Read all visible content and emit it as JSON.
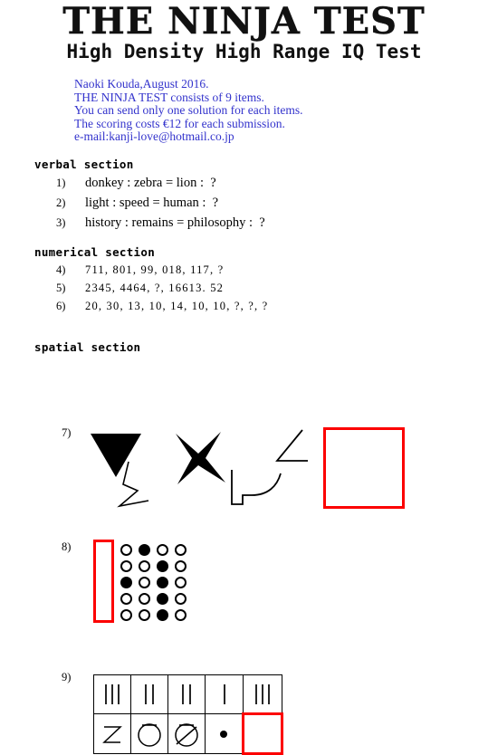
{
  "header": {
    "main_title": "THE NINJA TEST",
    "sub_title": "High Density  High Range IQ Test"
  },
  "intro": {
    "line1": "Naoki Kouda,August 2016.",
    "line2": "THE NINJA TEST consists of 9 items.",
    "line3": "You can send only one solution  for each items.",
    "line4": "The scoring costs €12 for each submission.",
    "line5": "e-mail:kanji-love@hotmail.co.jp",
    "color": "#3333cc"
  },
  "sections": {
    "verbal": {
      "title": "verbal section",
      "items": [
        {
          "num": "1)",
          "text": "donkey : zebra = lion :  ?"
        },
        {
          "num": "2)",
          "text": "light : speed = human :  ?"
        },
        {
          "num": "3)",
          "text": "history : remains = philosophy :  ?"
        }
      ]
    },
    "numerical": {
      "title": "numerical section",
      "items": [
        {
          "num": "4)",
          "text": "711, 801, 99, 018, 117, ?"
        },
        {
          "num": "5)",
          "text": "2345, 4464, ?, 16613. 52"
        },
        {
          "num": "6)",
          "text": "20, 30, 13, 10, 14, 10, 10, ?, ?, ?"
        }
      ]
    },
    "spatial": {
      "title": "spatial section",
      "items": [
        {
          "num": "7)",
          "type": "shape-sequence",
          "figures": [
            "filled-triangle-with-open-zigzag",
            "filled-four-point-star",
            "open-bracket-with-curve",
            "open-angle-line"
          ],
          "answer": "empty-red-square"
        },
        {
          "num": "8)",
          "type": "dot-grid",
          "columns": 4,
          "rows": 5,
          "grid": [
            [
              0,
              1,
              0,
              0
            ],
            [
              0,
              0,
              1,
              0
            ],
            [
              1,
              0,
              1,
              0
            ],
            [
              0,
              0,
              1,
              0
            ],
            [
              0,
              0,
              1,
              0
            ]
          ],
          "answer": "empty-red-vertical-bar"
        },
        {
          "num": "9)",
          "type": "matrix-table",
          "top_row": [
            "3-strokes",
            "2-strokes",
            "2-strokes",
            "1-stroke",
            "3-strokes"
          ],
          "bottom_row": [
            "z-shape",
            "circle",
            "circle-with-slash",
            "small-dot",
            "answer"
          ],
          "answer": "empty-red-cell"
        }
      ]
    }
  },
  "colors": {
    "red_answer": "#fc0000",
    "intro_blue": "#3333cc",
    "ink": "#000000"
  }
}
